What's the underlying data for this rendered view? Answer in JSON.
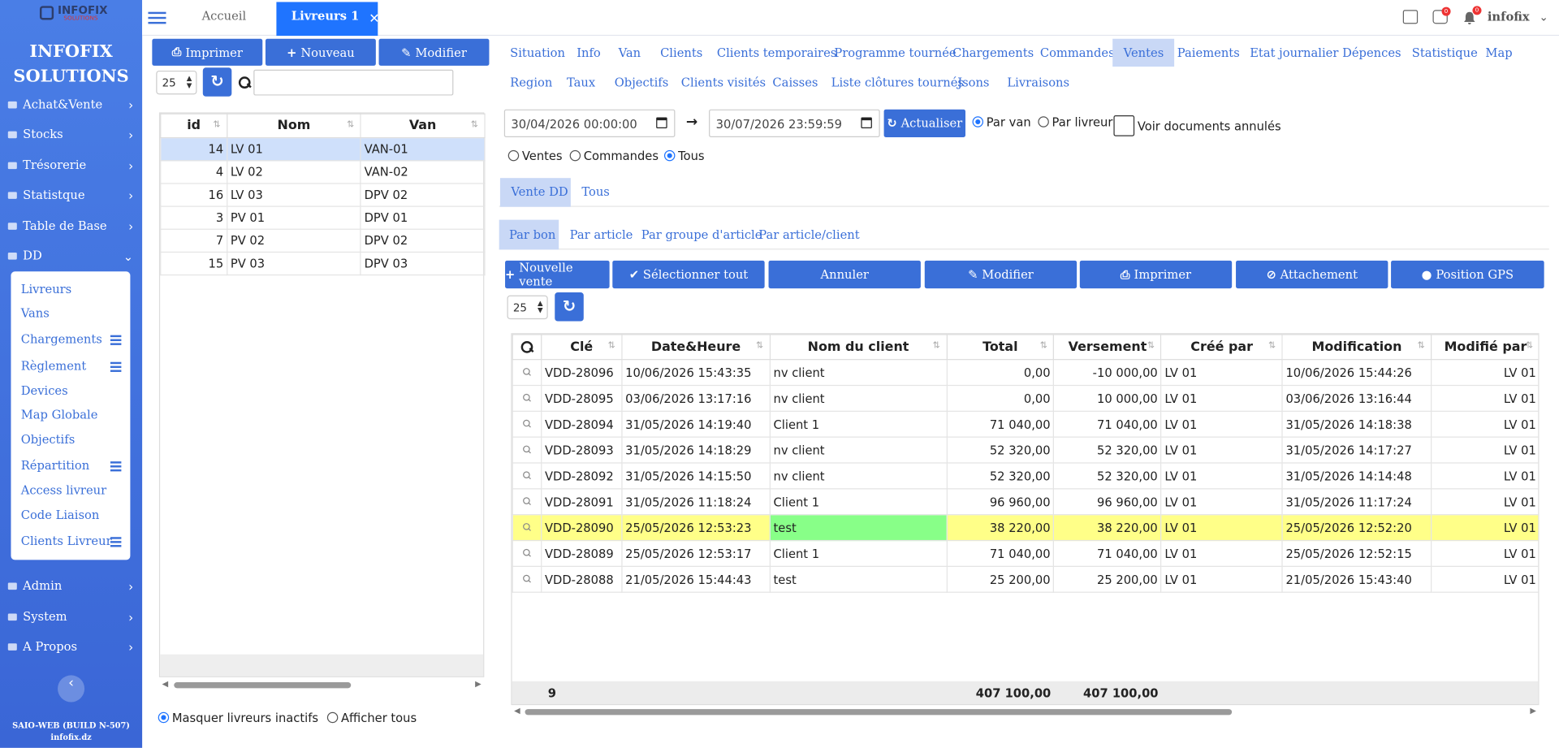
{
  "logo": {
    "text": "INFOFIX",
    "sub": "SOLUTIONS"
  },
  "brand": {
    "line1": "INFOFIX",
    "line2": "SOLUTIONS"
  },
  "sidebar": {
    "items": [
      {
        "label": "Achat&Vente"
      },
      {
        "label": "Stocks"
      },
      {
        "label": "Trésorerie"
      },
      {
        "label": "Statistque"
      },
      {
        "label": "Table de Base"
      },
      {
        "label": "DD"
      },
      {
        "label": "Admin"
      },
      {
        "label": "System"
      },
      {
        "label": "A Propos"
      }
    ],
    "submenu": [
      {
        "label": "Livreurs"
      },
      {
        "label": "Vans"
      },
      {
        "label": "Chargements"
      },
      {
        "label": "Règlement"
      },
      {
        "label": "Devices"
      },
      {
        "label": "Map Globale"
      },
      {
        "label": "Objectifs"
      },
      {
        "label": "Répartition"
      },
      {
        "label": "Access livreur"
      },
      {
        "label": "Code Liaison"
      },
      {
        "label": "Clients Livreur"
      }
    ],
    "build_line1": "SAIO-WEB (BUILD N-507)",
    "build_line2": "infofix.dz"
  },
  "topbar": {
    "home_tab": "Accueil",
    "active_tab": "Livreurs 1",
    "badge1": "0",
    "badge2": "0",
    "user": "infofix"
  },
  "left": {
    "buttons": {
      "print": "Imprimer",
      "new": "Nouveau",
      "edit": "Modifier"
    },
    "page_size": "25",
    "search_value": "",
    "columns": [
      "id",
      "Nom",
      "Van"
    ],
    "rows": [
      [
        "14",
        "LV 01",
        "VAN-01"
      ],
      [
        "4",
        "LV 02",
        "VAN-02"
      ],
      [
        "16",
        "LV 03",
        "DPV 02"
      ],
      [
        "3",
        "PV 01",
        "DPV 01"
      ],
      [
        "7",
        "PV 02",
        "DPV 02"
      ],
      [
        "15",
        "PV 03",
        "DPV 03"
      ]
    ],
    "radio_hide": "Masquer livreurs inactifs",
    "radio_all": "Afficher tous"
  },
  "right": {
    "nav_row1": [
      "Situation",
      "Info",
      "Van",
      "Clients",
      "Clients temporaires",
      "Programme tournée",
      "Chargements",
      "Commandes",
      "Ventes",
      "Paiements",
      "Etat journalier",
      "Dépences",
      "Statistique",
      "Map"
    ],
    "nav_row2": [
      "Region",
      "Taux",
      "Objectifs",
      "Clients visités",
      "Caisses",
      "Liste clôtures tournés",
      "Jsons",
      "Livraisons"
    ],
    "active_nav": "Ventes",
    "date_from": "30/04/2026 00:00:00",
    "date_to": "30/07/2026 23:59:59",
    "refresh_label": "Actualiser",
    "radio_van": "Par van",
    "radio_livreur": "Par livreur",
    "show_cancelled": "Voir documents annulés",
    "radio_ventes": "Ventes",
    "radio_commandes": "Commandes",
    "radio_tous": "Tous",
    "tab_vente_dd": "Vente DD",
    "tab_tous": "Tous",
    "subtabs": [
      "Par bon",
      "Par article",
      "Par groupe d'article",
      "Par article/client"
    ],
    "actions": [
      "Nouvelle vente",
      "Sélectionner tout",
      "Annuler",
      "Modifier",
      "Imprimer",
      "Attachement",
      "Position GPS"
    ],
    "page_size": "25",
    "grid": {
      "columns": [
        "Clé",
        "Date&Heure",
        "Nom du client",
        "Total",
        "Versement",
        "Créé par",
        "Modification",
        "Modifié par"
      ],
      "rows": [
        [
          "VDD-28096",
          "10/06/2026 15:43:35",
          "nv client",
          "0,00",
          "-10 000,00",
          "LV 01",
          "10/06/2026 15:44:26",
          "LV 01"
        ],
        [
          "VDD-28095",
          "03/06/2026 13:17:16",
          "nv client",
          "0,00",
          "10 000,00",
          "LV 01",
          "03/06/2026 13:16:44",
          "LV 01"
        ],
        [
          "VDD-28094",
          "31/05/2026 14:19:40",
          "Client 1",
          "71 040,00",
          "71 040,00",
          "LV 01",
          "31/05/2026 14:18:38",
          "LV 01"
        ],
        [
          "VDD-28093",
          "31/05/2026 14:18:29",
          "nv client",
          "52 320,00",
          "52 320,00",
          "LV 01",
          "31/05/2026 14:17:27",
          "LV 01"
        ],
        [
          "VDD-28092",
          "31/05/2026 14:15:50",
          "nv client",
          "52 320,00",
          "52 320,00",
          "LV 01",
          "31/05/2026 14:14:48",
          "LV 01"
        ],
        [
          "VDD-28091",
          "31/05/2026 11:18:24",
          "Client 1",
          "96 960,00",
          "96 960,00",
          "LV 01",
          "31/05/2026 11:17:24",
          "LV 01"
        ],
        [
          "VDD-28090",
          "25/05/2026 12:53:23",
          "test",
          "38 220,00",
          "38 220,00",
          "LV 01",
          "25/05/2026 12:52:20",
          "LV 01"
        ],
        [
          "VDD-28089",
          "25/05/2026 12:53:17",
          "Client 1",
          "71 040,00",
          "71 040,00",
          "LV 01",
          "25/05/2026 12:52:15",
          "LV 01"
        ],
        [
          "VDD-28088",
          "21/05/2026 15:44:43",
          "test",
          "25 200,00",
          "25 200,00",
          "LV 01",
          "21/05/2026 15:43:40",
          "LV 01"
        ]
      ],
      "footer_count": "9",
      "footer_total": "407 100,00",
      "footer_versement": "407 100,00"
    }
  },
  "colors": {
    "primary": "#3a6fd8",
    "active_tab": "#1f74ff",
    "highlight_row": "#ffff88",
    "highlight_cell": "#88ff88",
    "selected_row": "#cfe0fb"
  }
}
